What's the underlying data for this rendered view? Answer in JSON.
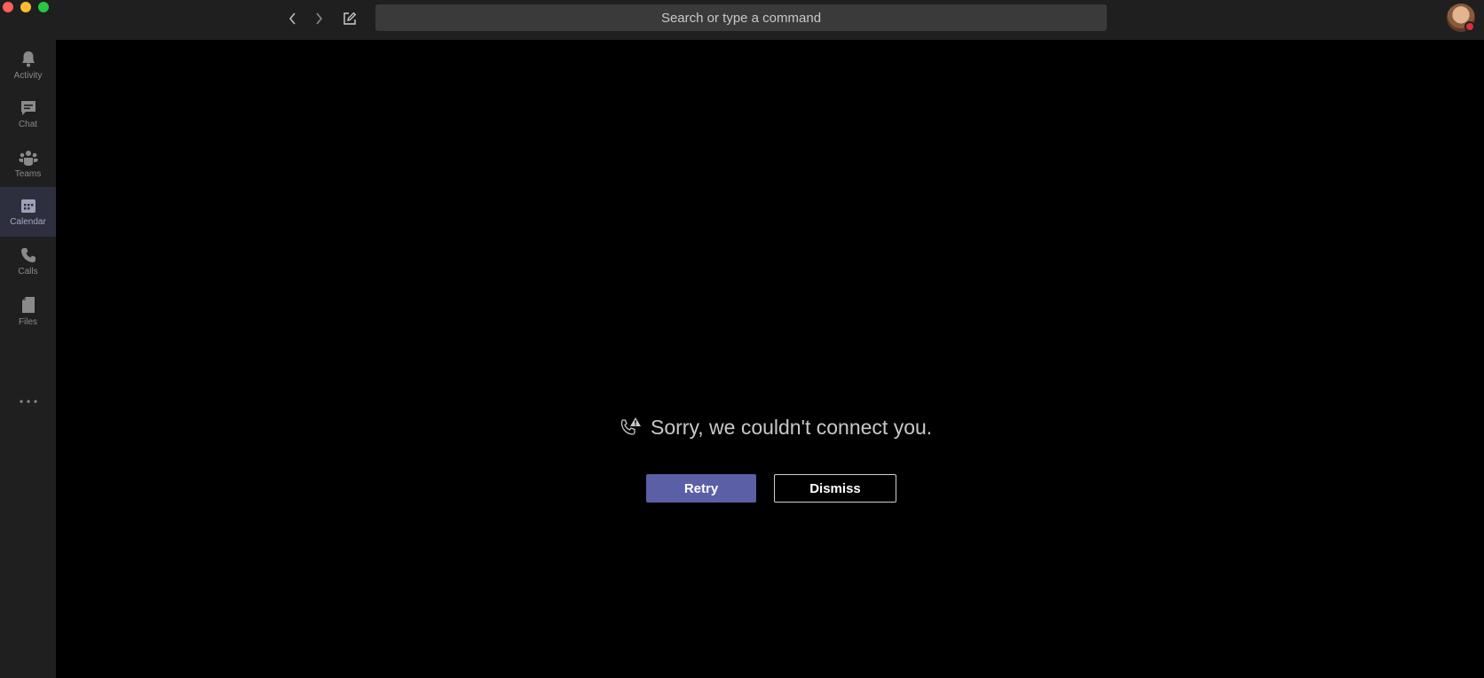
{
  "search": {
    "placeholder": "Search or type a command"
  },
  "rail": {
    "items": [
      {
        "id": "activity",
        "label": "Activity",
        "icon": "bell-icon"
      },
      {
        "id": "chat",
        "label": "Chat",
        "icon": "chat-icon"
      },
      {
        "id": "teams",
        "label": "Teams",
        "icon": "teams-icon"
      },
      {
        "id": "calendar",
        "label": "Calendar",
        "icon": "calendar-icon",
        "active": true
      },
      {
        "id": "calls",
        "label": "Calls",
        "icon": "phone-icon"
      },
      {
        "id": "files",
        "label": "Files",
        "icon": "file-icon"
      }
    ],
    "more_icon": "more-icon"
  },
  "call_error": {
    "message": "Sorry, we couldn't connect you.",
    "icon": "call-warning-icon",
    "retry_label": "Retry",
    "dismiss_label": "Dismiss"
  },
  "colors": {
    "accent": "#5b5fa6",
    "presence_busy": "#d9303b",
    "chrome": "#1f1f1f"
  }
}
